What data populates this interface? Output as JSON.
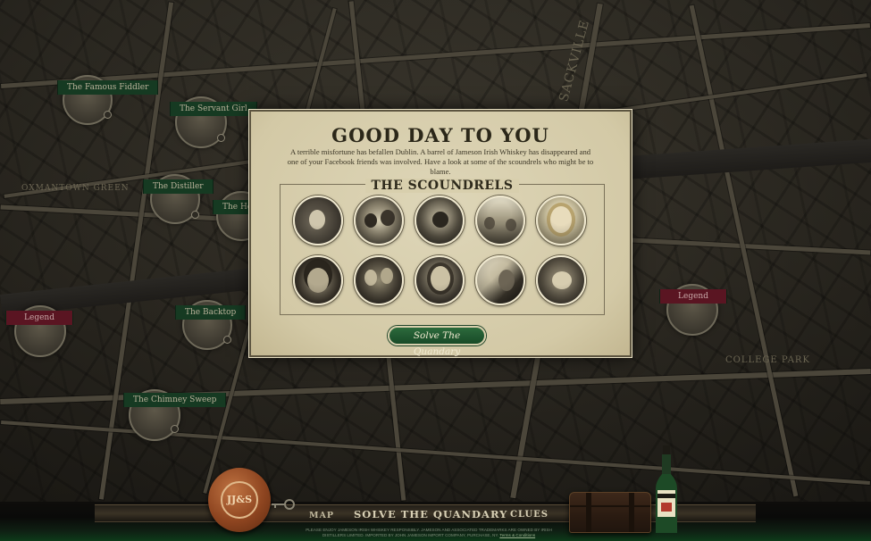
{
  "map": {
    "words": [
      "SACKVILLE",
      "COLLEGE PARK",
      "OXMANTOWN GREEN"
    ],
    "pins": [
      {
        "label": "The Famous Fiddler",
        "kind": "friend"
      },
      {
        "label": "The Servant Girl",
        "kind": "friend"
      },
      {
        "label": "The Distiller",
        "kind": "friend"
      },
      {
        "label": "The He",
        "kind": "friend"
      },
      {
        "label": "Legend",
        "kind": "legend"
      },
      {
        "label": "The Backtop",
        "kind": "friend"
      },
      {
        "label": "The Chimney Sweep",
        "kind": "friend"
      },
      {
        "label": "Legend",
        "kind": "legend"
      }
    ]
  },
  "dialog": {
    "title": "GOOD DAY TO YOU",
    "intro": "A terrible misfortune has befallen Dublin. A barrel of Jameson Irish Whiskey has disappeared and one of your Facebook friends was involved. Have a look at some of the scoundrels who might be to blame.",
    "scoundrels_heading": "THE SCOUNDRELS",
    "scoundrels": [
      {
        "name": "scoundrel-1"
      },
      {
        "name": "scoundrel-2"
      },
      {
        "name": "scoundrel-3"
      },
      {
        "name": "scoundrel-4"
      },
      {
        "name": "scoundrel-5"
      },
      {
        "name": "scoundrel-6"
      },
      {
        "name": "scoundrel-7"
      },
      {
        "name": "scoundrel-8"
      },
      {
        "name": "scoundrel-9"
      },
      {
        "name": "scoundrel-10"
      }
    ],
    "solve_button": "Solve The Quandary"
  },
  "bottom_bar": {
    "seal_text": "JJ&S",
    "nav": {
      "map": "MAP",
      "solve": "SOLVE THE QUANDARY",
      "clues": "CLUES"
    },
    "footer_text": "PLEASE ENJOY JAMESON IRISH WHISKEY RESPONSIBLY. JAMESON AND ASSOCIATED TRADEMARKS ARE OWNED BY IRISH DISTILLERS LIMITED. IMPORTED BY JOHN JAMESON IMPORT COMPANY, PURCHASE, NY.",
    "footer_link": "Terms & Conditions"
  },
  "colors": {
    "parchment": "#d9d0b0",
    "button_green": "#184a27",
    "legend_red": "#5a1522",
    "label_green": "#163a22"
  }
}
